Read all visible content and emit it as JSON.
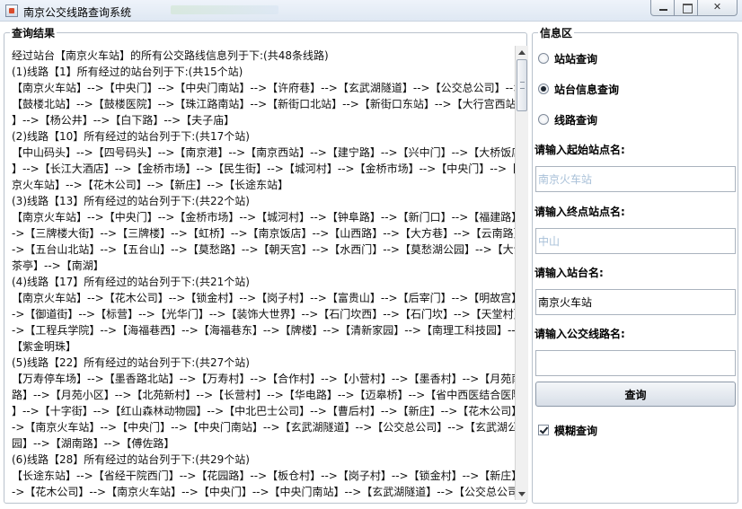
{
  "window": {
    "title": "南京公交线路查询系统",
    "icon": "java-app-icon",
    "buttons": [
      "minimize",
      "maximize",
      "close"
    ],
    "close_symbol": "✕"
  },
  "results": {
    "title": "查询结果",
    "lines": [
      "经过站台【南京火车站】的所有公交路线信息列于下:(共48条线路)",
      "(1)线路【1】所有经过的站台列于下:(共15个站)",
      "【南京火车站】-->【中央门】-->【中央门南站】-->【许府巷】-->【玄武湖隧道】-->【公交总公司】-->",
      "【鼓楼北站】-->【鼓楼医院】-->【珠江路南站】-->【新街口北站】-->【新街口东站】-->【大行宫西站",
      "】-->【杨公井】-->【白下路】-->【夫子庙】",
      "(2)线路【10】所有经过的站台列于下:(共17个站)",
      "【中山码头】-->【四号码头】-->【南京港】-->【南京西站】-->【建宁路】-->【兴中门】-->【大桥饭店",
      "】-->【长江大酒店】-->【金桥市场】-->【民生街】-->【城河村】-->【金桥市场】-->【中央门】-->【南",
      "京火车站】-->【花木公司】-->【新庄】-->【长途东站】",
      "(3)线路【13】所有经过的站台列于下:(共22个站)",
      "【南京火车站】-->【中央门】-->【金桥市场】-->【城河村】-->【钟阜路】-->【新门口】-->【福建路】-",
      "->【三牌楼大街】-->【三牌楼】-->【虹桥】-->【南京饭店】-->【山西路】-->【大方巷】-->【云南路】-",
      "->【五台山北站】-->【五台山】-->【莫愁路】-->【朝天宫】-->【水西门】-->【莫愁湖公园】-->【大士",
      "茶亭】-->【南湖】",
      "(4)线路【17】所有经过的站台列于下:(共21个站)",
      "【南京火车站】-->【花木公司】-->【锁金村】-->【岗子村】-->【富贵山】-->【后宰门】-->【明故宫】-",
      "->【御道街】-->【标营】-->【光华门】-->【装饰大世界】-->【石门坎西】-->【石门坎】-->【天堂村】-",
      "->【工程兵学院】-->【海福巷西】-->【海福巷东】-->【牌楼】-->【清新家园】-->【南理工科技园】-->",
      "【紫金明珠】",
      "(5)线路【22】所有经过的站台列于下:(共27个站)",
      "【万寿停车场】-->【墨香路北站】-->【万寿村】-->【合作村】-->【小营村】-->【墨香村】-->【月苑南",
      "路】-->【月苑小区】-->【北苑新村】-->【长营村】-->【华电路】-->【迈皋桥】-->【省中西医结合医院",
      "】-->【十字街】-->【红山森林动物园】-->【中北巴士公司】-->【曹后村】-->【新庄】-->【花木公司】-",
      "->【南京火车站】-->【中央门】-->【中央门南站】-->【玄武湖隧道】-->【公交总公司】-->【玄武湖公",
      "园】-->【湖南路】-->【傅佐路】",
      "(6)线路【28】所有经过的站台列于下:(共29个站)",
      "【长途东站】-->【省经干院西门】-->【花园路】-->【板仓村】-->【岗子村】-->【锁金村】-->【新庄】-",
      "->【花木公司】-->【南京火车站】-->【中央门】-->【中央门南站】-->【玄武湖隧道】-->【公交总公司"
    ]
  },
  "info": {
    "title": "信息区",
    "radios": [
      {
        "label": "站站查询",
        "checked": false
      },
      {
        "label": "站台信息查询",
        "checked": true
      },
      {
        "label": "线路查询",
        "checked": false
      }
    ],
    "start_label": "请输入起始站点名:",
    "start_placeholder": "南京火车站",
    "end_label": "请输入终点站点名:",
    "end_placeholder": "中山",
    "station_label": "请输入站台名:",
    "station_value": "南京火车站",
    "route_label": "请输入公交线路名:",
    "route_value": "",
    "query_button": "查询",
    "fuzzy_label": "模糊查询",
    "fuzzy_checked": true
  }
}
